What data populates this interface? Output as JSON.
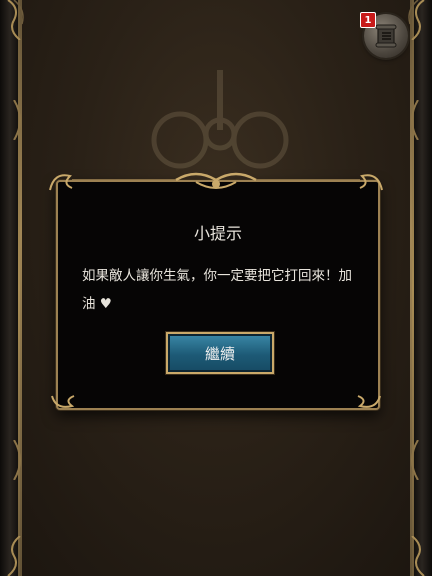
{
  "menu": {
    "badge_count": "1",
    "icon": "list-scroll-icon"
  },
  "dialog": {
    "title": "小提示",
    "message": "如果敵人讓你生氣，你一定要把它打回來！加油 ♥",
    "continue_label": "繼續"
  },
  "colors": {
    "frame_gold": "#9c8152",
    "button_blue": "#1d5a76",
    "badge_red": "#c81a1a",
    "dialog_bg": "#060505"
  }
}
